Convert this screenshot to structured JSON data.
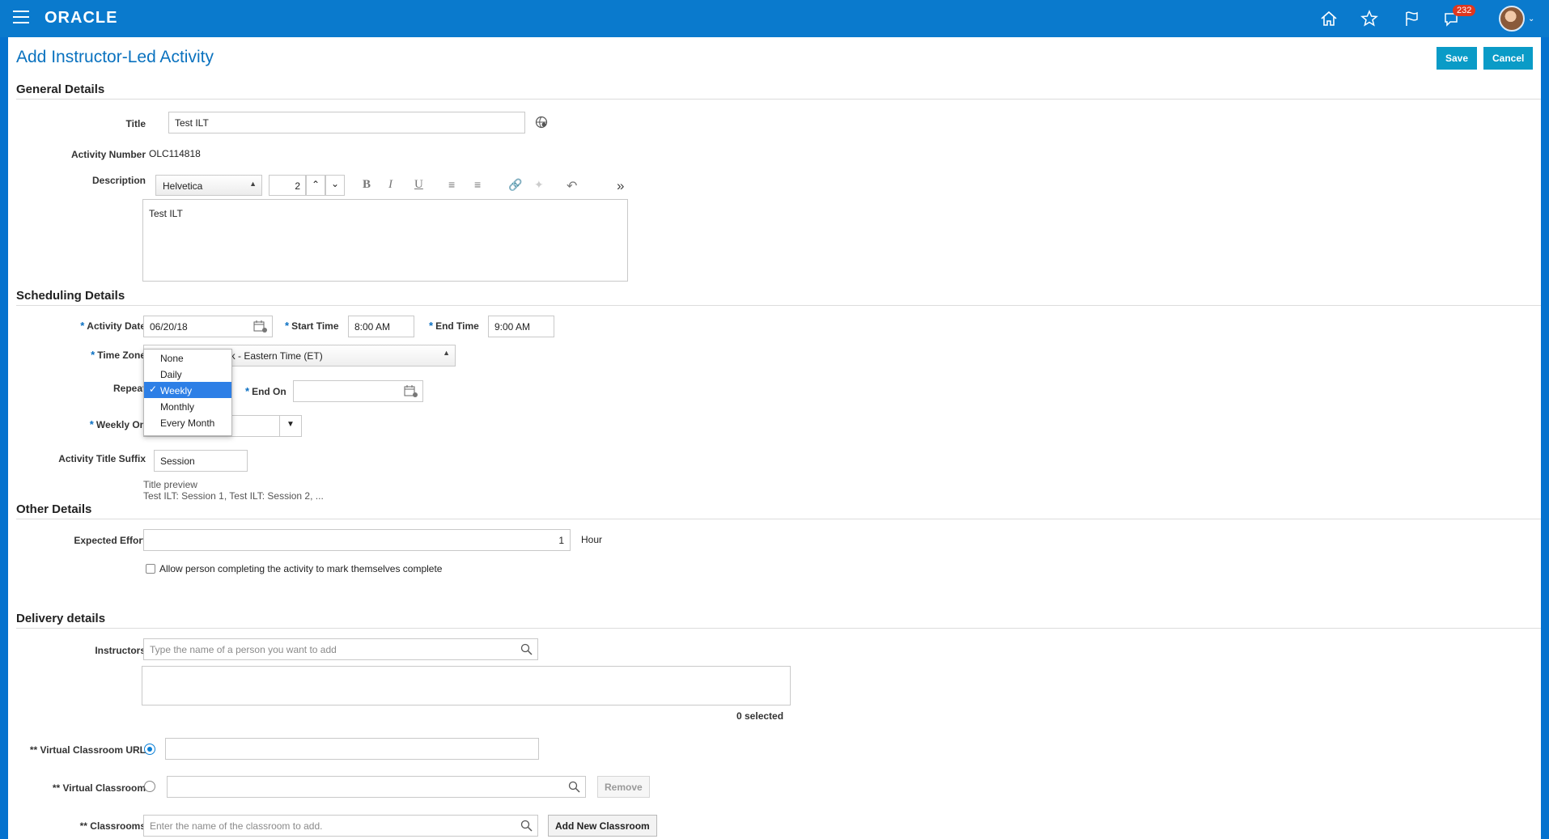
{
  "app": {
    "brand": "ORACLE",
    "notification_count": "232"
  },
  "header_icons": [
    "home-icon",
    "star-icon",
    "flag-icon",
    "notifications-icon"
  ],
  "page": {
    "title": "Add Instructor-Led Activity",
    "save_label": "Save",
    "cancel_label": "Cancel"
  },
  "general": {
    "section_title": "General Details",
    "title_label": "Title",
    "title_value": "Test ILT",
    "activity_number_label": "Activity Number",
    "activity_number_value": "OLC114818",
    "description_label": "Description",
    "font_name": "Helvetica",
    "font_size": "2",
    "description_text": "Test ILT"
  },
  "scheduling": {
    "section_title": "Scheduling Details",
    "activity_date_label": "Activity Date",
    "activity_date_value": "06/20/18",
    "start_time_label": "Start Time",
    "start_time_value": "8:00 AM",
    "end_time_label": "End Time",
    "end_time_value": "9:00 AM",
    "time_zone_label": "Time Zone",
    "time_zone_value_visible": "ork - Eastern Time (ET)",
    "repeat_label": "Repeat",
    "repeat_options": [
      "None",
      "Daily",
      "Weekly",
      "Monthly",
      "Every Month"
    ],
    "repeat_selected": "Weekly",
    "end_on_label": "End On",
    "end_on_value": "",
    "weekly_on_label": "Weekly On",
    "suffix_label": "Activity Title Suffix",
    "suffix_value": "Session",
    "preview_label": "Title preview",
    "preview_value": "Test ILT: Session 1, Test ILT: Session 2, ..."
  },
  "other": {
    "section_title": "Other Details",
    "effort_label": "Expected Effort",
    "effort_value": "1",
    "effort_unit": "Hour",
    "self_complete_label": "Allow person completing the activity to mark themselves complete",
    "self_complete_checked": false
  },
  "delivery": {
    "section_title": "Delivery details",
    "instructors_label": "Instructors",
    "instructors_placeholder": "Type the name of a person you want to add",
    "selected_count": "0 selected",
    "vc_url_label": "Virtual Classroom URL",
    "vc_url_selected": true,
    "vc_label": "Virtual Classroom",
    "remove_label": "Remove",
    "classrooms_label": "Classrooms",
    "classrooms_placeholder": "Enter the name of the classroom to add.",
    "add_classroom_label": "Add New Classroom",
    "double_star": "**"
  },
  "colors": {
    "header_blue": "#0a7acd",
    "title_blue": "#0a72bf",
    "button_teal": "#0a9bc7",
    "selection_blue": "#2d7fe6",
    "badge_red": "#e0371f"
  }
}
